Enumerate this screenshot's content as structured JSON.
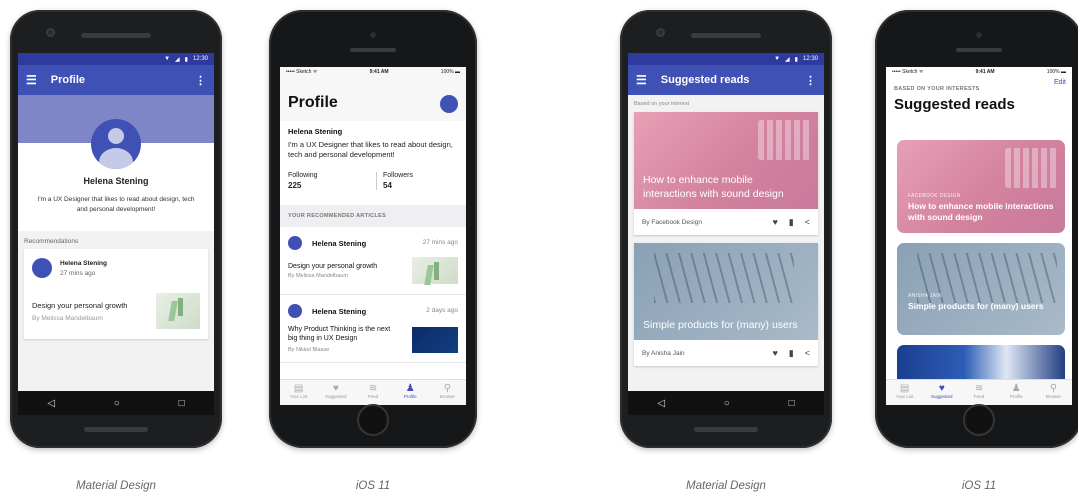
{
  "phone1": {
    "status_time": "12:30",
    "appbar_title": "Profile",
    "name": "Helena Stening",
    "bio": "I'm a UX Designer that likes to read about design, tech and personal development!",
    "section": "Recommendations",
    "card": {
      "author": "Helena Stening",
      "ago": "27 mins ago",
      "title": "Design your personal growth",
      "by": "By Melissa Mandelbaum"
    },
    "nav": [
      "◁",
      "○",
      "□"
    ]
  },
  "phone2": {
    "status_carrier": "••••• Sketch ᯤ",
    "status_time": "9:41 AM",
    "status_battery": "100% ▬",
    "title": "Profile",
    "name": "Helena Stening",
    "bio": "I'm a UX Designer that likes to read about design, tech and personal development!",
    "following_label": "Following",
    "following_value": "225",
    "followers_label": "Followers",
    "followers_value": "54",
    "section": "YOUR RECOMMENDED ARTICLES",
    "articles": [
      {
        "author": "Helena Stening",
        "ago": "27 mins ago",
        "title": "Design your personal growth",
        "by": "By Melissa Mandelbaum"
      },
      {
        "author": "Helena Stening",
        "ago": "2 days ago",
        "title": "Why Product Thinking is the next big thing in UX Design",
        "by": "By Nikkel Blaase"
      }
    ],
    "tabs": [
      {
        "label": "Your List",
        "icon": "▤"
      },
      {
        "label": "Suggested",
        "icon": "♥"
      },
      {
        "label": "Feed",
        "icon": "≋"
      },
      {
        "label": "Profile",
        "icon": "♟"
      },
      {
        "label": "Browse",
        "icon": "⚲"
      }
    ],
    "active_tab": "Profile"
  },
  "phone3": {
    "status_time": "12:30",
    "appbar_title": "Suggested reads",
    "label": "Based on your interest",
    "cards": [
      {
        "caption": "How to enhance mobile interactions with sound design",
        "source": "By Facebook Design"
      },
      {
        "caption": "Simple products for (many) users",
        "source": "By Anisha Jain"
      }
    ],
    "nav": [
      "◁",
      "○",
      "□"
    ]
  },
  "phone4": {
    "status_carrier": "••••• Sketch ᯤ",
    "status_time": "9:41 AM",
    "status_battery": "100% ▬",
    "edit": "Edit",
    "kicker": "BASED ON YOUR INTERESTS",
    "title": "Suggested reads",
    "cards": [
      {
        "source": "FACEBOOK DESIGN",
        "caption": "How to enhance mobile interactions with sound design"
      },
      {
        "source": "ANISHA JAIN",
        "caption": "Simple products for (many) users"
      }
    ],
    "tabs": [
      {
        "label": "Your List",
        "icon": "▤"
      },
      {
        "label": "Suggested",
        "icon": "♥"
      },
      {
        "label": "Feed",
        "icon": "≋"
      },
      {
        "label": "Profile",
        "icon": "♟"
      },
      {
        "label": "Browse",
        "icon": "⚲"
      }
    ],
    "active_tab": "Suggested"
  },
  "captions": [
    "Material Design",
    "iOS 11",
    "Material Design",
    "iOS 11"
  ],
  "colors": {
    "primary": "#3f51b5",
    "primary_dark": "#2e3a9e",
    "cover": "#7e86c7"
  }
}
